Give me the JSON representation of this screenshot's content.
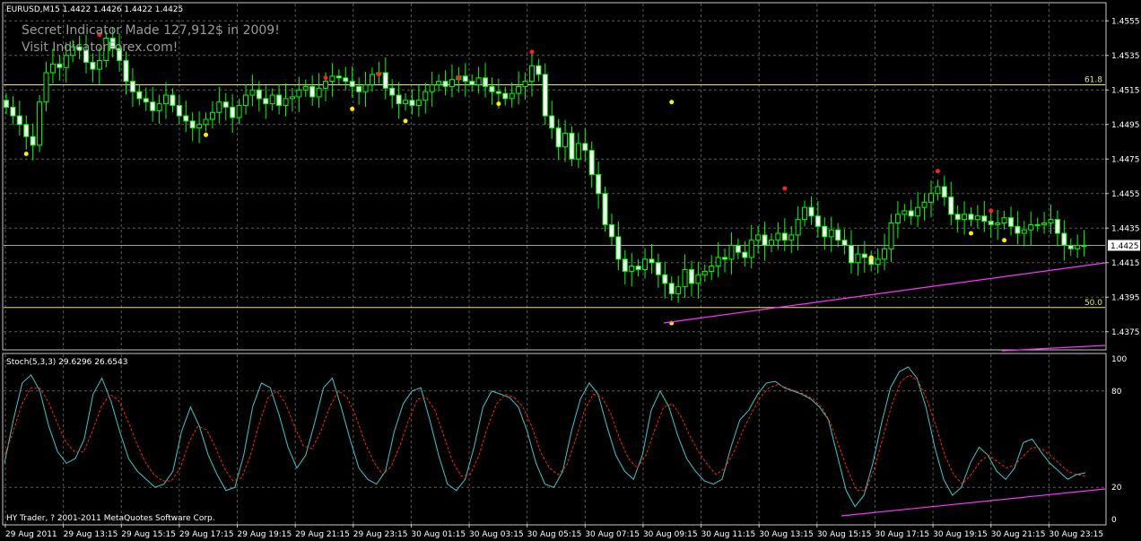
{
  "header": {
    "symbol_line": "EURUSD,M15  1.4422 1.4426 1.4422 1.4425",
    "watermark_line1": "Secret Indicator Made 127,912$ in 2009!",
    "watermark_line2": "Visit IndicatorForex.com!"
  },
  "stoch_header": "Stoch(5,3,3) 29.6296 26.6543",
  "copyright": "HY Trader, ? 2001-2011 MetaQuotes Software Corp.",
  "colors": {
    "background": "#000000",
    "grid": "#5a5a5a",
    "frame": "#c8c8c8",
    "candle": "#00ff00",
    "candle_bull_body": "#000000",
    "candle_bear_body": "#ffffff",
    "fib_line": "#e8e86a",
    "trendline": "#ff33ff",
    "dot_high": "#ff2020",
    "dot_low": "#ffee00",
    "stoch_main": "#40c8c8",
    "stoch_signal": "#ff2020",
    "axis_text": "#ffffff"
  },
  "chart_data": [
    {
      "type": "candlestick",
      "symbol": "EURUSD",
      "timeframe": "M15",
      "ylim": [
        1.4365,
        1.4565
      ],
      "y_ticks": [
        "1.4555",
        "1.4535",
        "1.4515",
        "1.4495",
        "1.4475",
        "1.4455",
        "1.4435",
        "1.4415",
        "1.4395",
        "1.4375"
      ],
      "current_price": "1.4425",
      "x_ticks": [
        "29 Aug 2011",
        "29 Aug 13:15",
        "29 Aug 15:15",
        "29 Aug 17:15",
        "29 Aug 19:15",
        "29 Aug 21:15",
        "29 Aug 23:15",
        "30 Aug 01:15",
        "30 Aug 03:15",
        "30 Aug 05:15",
        "30 Aug 07:15",
        "30 Aug 09:15",
        "30 Aug 11:15",
        "30 Aug 13:15",
        "30 Aug 15:15",
        "30 Aug 17:15",
        "30 Aug 19:15",
        "30 Aug 21:15",
        "30 Aug 23:15"
      ],
      "levels": [
        {
          "label": "61.8",
          "value": 1.4518
        },
        {
          "label": "50.0",
          "value": 1.4389
        }
      ],
      "candle_closes": [
        1.4505,
        1.45,
        1.4495,
        1.4488,
        1.4483,
        1.4508,
        1.4525,
        1.453,
        1.4528,
        1.4535,
        1.454,
        1.4538,
        1.4531,
        1.4527,
        1.4532,
        1.4545,
        1.4539,
        1.4532,
        1.452,
        1.4514,
        1.451,
        1.4508,
        1.4503,
        1.4507,
        1.4512,
        1.4506,
        1.45,
        1.4497,
        1.4493,
        1.4495,
        1.4498,
        1.4502,
        1.4508,
        1.4505,
        1.4499,
        1.4506,
        1.4512,
        1.4515,
        1.451,
        1.4507,
        1.4512,
        1.4506,
        1.451,
        1.4511,
        1.4515,
        1.4517,
        1.4511,
        1.4516,
        1.452,
        1.4523,
        1.4522,
        1.452,
        1.4517,
        1.4514,
        1.4518,
        1.4524,
        1.4525,
        1.4516,
        1.4512,
        1.4507,
        1.4509,
        1.4506,
        1.4509,
        1.4514,
        1.4518,
        1.452,
        1.4517,
        1.4521,
        1.4523,
        1.452,
        1.4518,
        1.4522,
        1.4517,
        1.4514,
        1.4513,
        1.451,
        1.4513,
        1.4517,
        1.452,
        1.4529,
        1.4524,
        1.45,
        1.4493,
        1.4482,
        1.449,
        1.4475,
        1.4484,
        1.448,
        1.4466,
        1.4455,
        1.4437,
        1.443,
        1.4417,
        1.441,
        1.4413,
        1.4411,
        1.4417,
        1.4415,
        1.4408,
        1.4403,
        1.4397,
        1.4401,
        1.4411,
        1.4403,
        1.4408,
        1.441,
        1.4413,
        1.4418,
        1.4417,
        1.4425,
        1.4421,
        1.4418,
        1.4428,
        1.4431,
        1.4425,
        1.4428,
        1.4432,
        1.4428,
        1.4431,
        1.444,
        1.4447,
        1.4442,
        1.4436,
        1.443,
        1.4434,
        1.4428,
        1.4425,
        1.4415,
        1.442,
        1.4418,
        1.4414,
        1.4417,
        1.4423,
        1.4438,
        1.4443,
        1.4445,
        1.4442,
        1.4447,
        1.445,
        1.4455,
        1.4459,
        1.4453,
        1.4443,
        1.444,
        1.4443,
        1.444,
        1.4442,
        1.4439,
        1.4437,
        1.4438,
        1.4441,
        1.4436,
        1.4432,
        1.4434,
        1.4437,
        1.4437,
        1.4438,
        1.444,
        1.4432,
        1.4425,
        1.4423,
        1.4425,
        1.4425
      ],
      "high_markers": [
        1.4547,
        1.4522,
        1.4524,
        1.4522,
        1.4537,
        1.4458,
        1.4468,
        1.4445
      ],
      "low_markers": [
        1.4478,
        1.4504,
        1.4489,
        1.4497,
        1.4507,
        1.4508,
        1.438,
        1.4418,
        1.4432,
        1.4428
      ],
      "trendlines": [
        "support line from 30 Aug 09:15 low to 30 Aug 23:15",
        "lower channel line (30 Aug 21:15 onward)"
      ]
    },
    {
      "type": "line",
      "title": "Stoch(5,3,3) 29.6296 26.6543",
      "ylim": [
        0,
        100
      ],
      "y_ticks": [
        "100",
        "80",
        "20",
        "0"
      ],
      "levels": [
        80,
        20
      ],
      "series": [
        {
          "name": "main",
          "values": [
            35,
            62,
            85,
            90,
            80,
            58,
            42,
            35,
            38,
            50,
            78,
            88,
            74,
            55,
            38,
            30,
            25,
            20,
            22,
            30,
            55,
            70,
            58,
            40,
            28,
            18,
            20,
            40,
            70,
            85,
            82,
            65,
            45,
            32,
            40,
            60,
            82,
            88,
            70,
            50,
            32,
            25,
            22,
            30,
            55,
            72,
            80,
            82,
            62,
            40,
            22,
            18,
            25,
            45,
            70,
            80,
            78,
            76,
            70,
            55,
            35,
            22,
            20,
            30,
            55,
            75,
            85,
            78,
            58,
            40,
            30,
            25,
            40,
            68,
            80,
            70,
            52,
            38,
            30,
            24,
            22,
            25,
            45,
            62,
            68,
            78,
            85,
            86,
            82,
            80,
            78,
            75,
            70,
            62,
            40,
            18,
            8,
            15,
            35,
            60,
            82,
            92,
            95,
            88,
            70,
            45,
            25,
            15,
            20,
            35,
            45,
            40,
            30,
            25,
            32,
            48,
            50,
            42,
            35,
            30,
            25,
            28,
            29
          ]
        },
        {
          "name": "signal",
          "values": [
            40,
            55,
            72,
            82,
            82,
            73,
            60,
            48,
            42,
            42,
            55,
            70,
            78,
            74,
            62,
            48,
            36,
            28,
            24,
            24,
            32,
            48,
            58,
            56,
            45,
            32,
            24,
            26,
            40,
            60,
            76,
            80,
            72,
            58,
            46,
            44,
            55,
            70,
            80,
            76,
            64,
            48,
            36,
            28,
            33,
            46,
            62,
            75,
            76,
            68,
            52,
            36,
            27,
            28,
            40,
            58,
            72,
            78,
            76,
            70,
            58,
            42,
            32,
            28,
            34,
            50,
            68,
            78,
            76,
            66,
            50,
            38,
            32,
            40,
            56,
            70,
            72,
            64,
            52,
            42,
            34,
            28,
            32,
            42,
            55,
            66,
            76,
            82,
            84,
            82,
            80,
            78,
            75,
            70,
            60,
            45,
            30,
            18,
            18,
            32,
            52,
            72,
            86,
            90,
            86,
            74,
            58,
            40,
            28,
            22,
            28,
            36,
            40,
            36,
            32,
            34,
            40,
            45,
            44,
            40,
            35,
            30,
            28,
            27
          ]
        }
      ]
    }
  ]
}
